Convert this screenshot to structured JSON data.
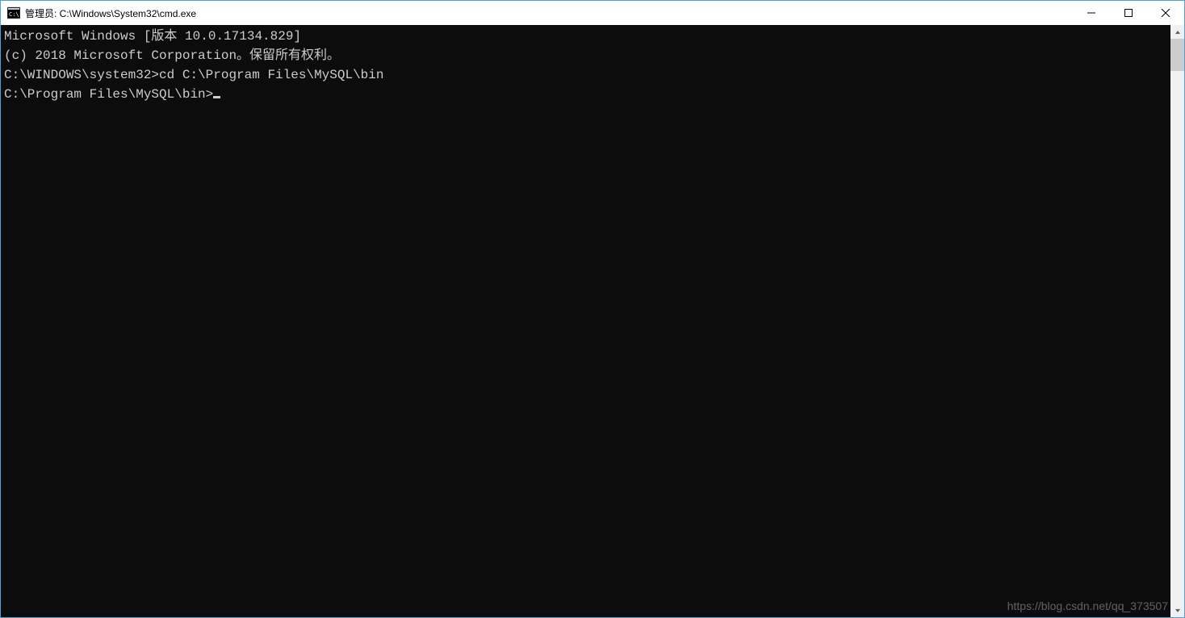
{
  "titlebar": {
    "text": "管理员: C:\\Windows\\System32\\cmd.exe"
  },
  "terminal": {
    "line1": "Microsoft Windows [版本 10.0.17134.829]",
    "line2": "(c) 2018 Microsoft Corporation。保留所有权利。",
    "blank1": "",
    "prompt1": "C:\\WINDOWS\\system32>",
    "command1": "cd C:\\Program Files\\MySQL\\bin",
    "blank2": "",
    "prompt2": "C:\\Program Files\\MySQL\\bin>"
  },
  "watermark": "https://blog.csdn.net/qq_373507"
}
